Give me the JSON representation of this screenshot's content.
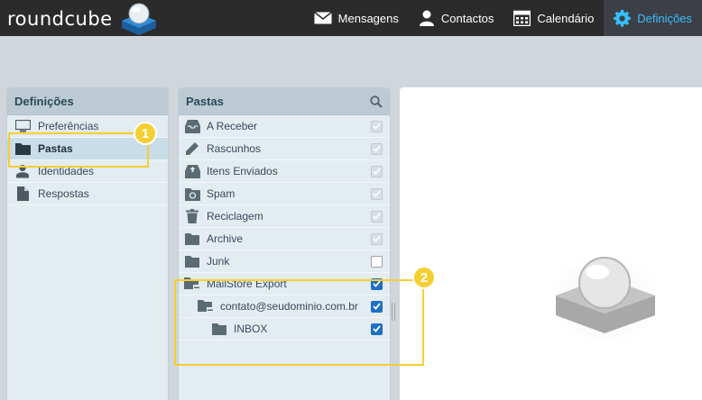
{
  "app": {
    "logo_text": "roundcube"
  },
  "nav": [
    {
      "label": "Mensagens",
      "icon": "envelope-icon",
      "active": false
    },
    {
      "label": "Contactos",
      "icon": "person-icon",
      "active": false
    },
    {
      "label": "Calendário",
      "icon": "calendar-icon",
      "active": false
    },
    {
      "label": "Definições",
      "icon": "gear-icon",
      "active": true
    }
  ],
  "settings": {
    "title": "Definições",
    "items": [
      {
        "label": "Preferências",
        "icon": "monitor-icon",
        "selected": false
      },
      {
        "label": "Pastas",
        "icon": "folder-icon",
        "selected": true
      },
      {
        "label": "Identidades",
        "icon": "identity-icon",
        "selected": false
      },
      {
        "label": "Respostas",
        "icon": "document-icon",
        "selected": false
      }
    ]
  },
  "folders": {
    "title": "Pastas",
    "items": [
      {
        "label": "A Receber",
        "icon": "inbox-icon",
        "subscribed": true,
        "disabled": true,
        "level": 0
      },
      {
        "label": "Rascunhos",
        "icon": "pencil-icon",
        "subscribed": true,
        "disabled": true,
        "level": 0
      },
      {
        "label": "Itens Enviados",
        "icon": "sent-icon",
        "subscribed": true,
        "disabled": true,
        "level": 0
      },
      {
        "label": "Spam",
        "icon": "spam-icon",
        "subscribed": true,
        "disabled": true,
        "level": 0
      },
      {
        "label": "Reciclagem",
        "icon": "trash-icon",
        "subscribed": true,
        "disabled": true,
        "level": 0
      },
      {
        "label": "Archive",
        "icon": "folder-icon",
        "subscribed": true,
        "disabled": true,
        "level": 0
      },
      {
        "label": "Junk",
        "icon": "folder-icon",
        "subscribed": false,
        "disabled": false,
        "level": 0
      },
      {
        "label": "MailStore Export",
        "icon": "folder-collapse-icon",
        "subscribed": true,
        "disabled": false,
        "level": 0
      },
      {
        "label": "contato@seudominio.com.br",
        "icon": "folder-collapse-icon",
        "subscribed": true,
        "disabled": false,
        "level": 1
      },
      {
        "label": "INBOX",
        "icon": "folder-icon",
        "subscribed": true,
        "disabled": false,
        "level": 2
      }
    ]
  },
  "annotations": {
    "badge1": "1",
    "badge2": "2"
  },
  "colors": {
    "accent": "#37beff",
    "highlight": "#f5cf32",
    "checkbox": "#1f6fc5"
  }
}
